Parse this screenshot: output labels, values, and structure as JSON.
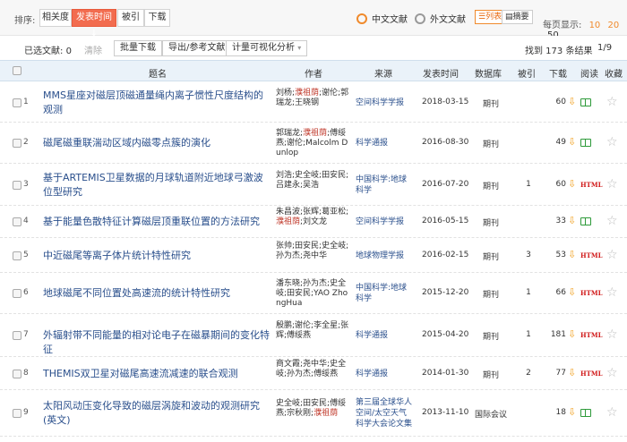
{
  "sort": {
    "label": "排序:",
    "options": [
      "相关度",
      "发表时间",
      "被引",
      "下载"
    ],
    "active_index": 1,
    "active_arrow": "↓"
  },
  "lang": {
    "chinese": "中文文献",
    "foreign": "外文文献"
  },
  "view": {
    "list": "列表",
    "summary": "摘要"
  },
  "perpage": {
    "label": "每页显示:",
    "opts": [
      "10",
      "20",
      "50"
    ],
    "current": "10"
  },
  "toolbar": {
    "selected": "已选文献:",
    "selected_count": "0",
    "clear": "清除",
    "batch_download": "批量下载",
    "export": "导出/参考文献",
    "visual": "计量可视化分析",
    "found": "找到 173 条结果",
    "page": "1/9"
  },
  "columns": {
    "title": "题名",
    "author": "作者",
    "source": "来源",
    "date": "发表时间",
    "db": "数据库",
    "cite": "被引",
    "download": "下载",
    "read": "阅读",
    "fav": "收藏"
  },
  "rows": [
    {
      "num": "1",
      "title": "MMS星座对磁层顶磁通量绳内离子惯性尺度结构的观测",
      "author_pre": "刘杨;",
      "author_hl": "濮祖荫",
      "author_post": ";谢伦;郭瑞龙;王晓钢",
      "source": "空间科学学报",
      "date": "2018-03-15",
      "db": "期刊",
      "cite": "",
      "dl": "60",
      "read": "book"
    },
    {
      "num": "2",
      "title": "磁尾磁重联湍动区域内磁零点簇的演化",
      "author_pre": "郭瑞龙;",
      "author_hl": "濮祖荫",
      "author_post": ";傅绥燕;谢伦;Malcolm Dunlop",
      "source": "科学通报",
      "date": "2016-08-30",
      "db": "期刊",
      "cite": "",
      "dl": "49",
      "read": "book"
    },
    {
      "num": "3",
      "title": "基于ARTEMIS卫星数据的月球轨道附近地球弓激波位型研究",
      "author_pre": "刘浩;史全岐;田安民;吕建永;吴浩",
      "author_hl": "",
      "author_post": "",
      "source": "中国科学:地球科学",
      "date": "2016-07-20",
      "db": "期刊",
      "cite": "1",
      "dl": "60",
      "read": "HTML"
    },
    {
      "num": "4",
      "title": "基于能量色散特征计算磁层顶重联位置的方法研究",
      "author_pre": "朱昌波;张辉;葛亚松;",
      "author_hl": "濮祖荫",
      "author_post": ";刘文龙",
      "source": "空间科学学报",
      "date": "2016-05-15",
      "db": "期刊",
      "cite": "",
      "dl": "33",
      "read": "book"
    },
    {
      "num": "5",
      "title": "中近磁尾等离子体片统计特性研究",
      "author_pre": "张帅;田安民;史全岐;孙为杰;尧中华",
      "author_hl": "",
      "author_post": "",
      "source": "地球物理学报",
      "date": "2016-02-15",
      "db": "期刊",
      "cite": "3",
      "dl": "53",
      "read": "HTML"
    },
    {
      "num": "6",
      "title": "地球磁尾不同位置处高速流的统计特性研究",
      "author_pre": "潘东晓;孙为杰;史全岐;田安民;YAO ZhongHua",
      "author_hl": "",
      "author_post": "",
      "source": "中国科学:地球科学",
      "date": "2015-12-20",
      "db": "期刊",
      "cite": "1",
      "dl": "66",
      "read": "HTML"
    },
    {
      "num": "7",
      "title": "外辐射带不同能量的相对论电子在磁暴期间的变化特征",
      "author_pre": "殷鹏;谢伦;李全星;张辉;傅绥燕",
      "author_hl": "",
      "author_post": "",
      "source": "科学通报",
      "date": "2015-04-20",
      "db": "期刊",
      "cite": "1",
      "dl": "181",
      "read": "HTML"
    },
    {
      "num": "8",
      "title": "THEMIS双卫星对磁尾高速流减速的联合观测",
      "author_pre": "商文霞;尧中华;史全岐;孙为杰;傅绥燕",
      "author_hl": "",
      "author_post": "",
      "source": "科学通报",
      "date": "2014-01-30",
      "db": "期刊",
      "cite": "2",
      "dl": "77",
      "read": "HTML"
    },
    {
      "num": "9",
      "title": "太阳风动压变化导致的磁层涡旋和波动的观测研究(英文)",
      "author_pre": "史全岐;田安民;傅绥燕;宗秋刚;",
      "author_hl": "濮祖荫",
      "author_post": "",
      "source": "第三届全球华人空间/太空天气科学大会论文集",
      "date": "2013-11-10",
      "db": "国际会议",
      "cite": "",
      "dl": "18",
      "read": "book"
    }
  ],
  "colors": {
    "accent": "#f26c4f",
    "link": "#2a4f8c",
    "header_bg": "#eaf2f9",
    "highlight": "#c0392b"
  }
}
